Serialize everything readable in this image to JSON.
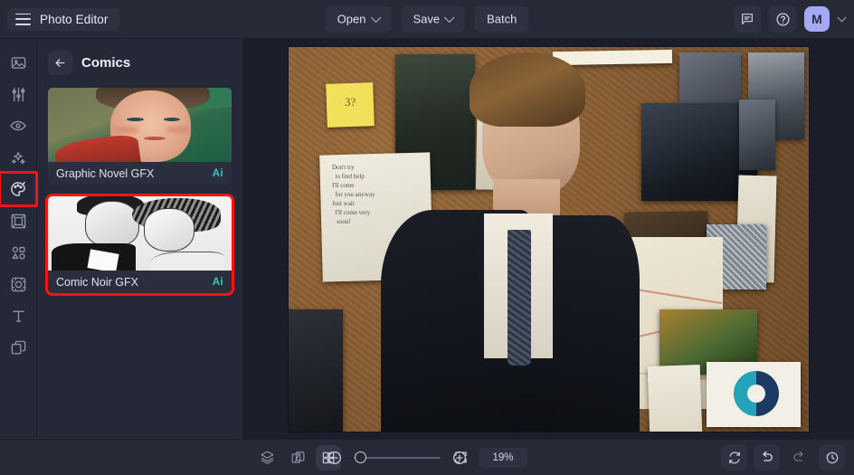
{
  "app": {
    "title": "Photo Editor",
    "menu_icon": "hamburger-icon",
    "background": "#1b1d2a",
    "surface": "#262936",
    "panel": "#252836",
    "accent_ai": "#3cc8bc",
    "accent_selection": "#f41414",
    "avatar_color": "#a5a8f5"
  },
  "header": {
    "open_label": "Open",
    "save_label": "Save",
    "batch_label": "Batch",
    "feedback_icon": "comment-icon",
    "help_icon": "help-circle-icon",
    "avatar_initial": "M",
    "avatar_chevron_icon": "chevron-down-icon"
  },
  "rail": {
    "items": [
      {
        "name": "image",
        "icon": "image-icon",
        "active": false
      },
      {
        "name": "adjust",
        "icon": "sliders-icon",
        "active": false
      },
      {
        "name": "retouch",
        "icon": "eye-icon",
        "active": false
      },
      {
        "name": "effects",
        "icon": "sparkles-icon",
        "active": false
      },
      {
        "name": "styles",
        "icon": "palette-icon",
        "active": true
      },
      {
        "name": "frames",
        "icon": "frame-icon",
        "active": false
      },
      {
        "name": "shapes",
        "icon": "shapes-icon",
        "active": false
      },
      {
        "name": "crop",
        "icon": "crop-focus-icon",
        "active": false
      },
      {
        "name": "text",
        "icon": "text-t-icon",
        "active": false
      },
      {
        "name": "layers",
        "icon": "layers-copy-icon",
        "active": false
      }
    ]
  },
  "panel": {
    "back_icon": "arrow-left-icon",
    "title": "Comics",
    "presets": [
      {
        "label": "Graphic Novel GFX",
        "badge": "Ai",
        "selected": false
      },
      {
        "label": "Comic Noir GFX",
        "badge": "Ai",
        "selected": true
      }
    ]
  },
  "canvas": {
    "description": "Man in dark suit and tie standing before an investigation corkboard with pinned photos, handwritten notes and a map",
    "sticky_note": "3?",
    "note_lines": [
      "Don't try",
      "to find help",
      "I'll come",
      "for you anyway",
      "Just wait",
      "I'll come very",
      "soon!"
    ]
  },
  "footer": {
    "layers_icon": "layers-icon",
    "compare_icon": "compare-icon",
    "grid_icon": "grid-icon",
    "fullscreen_icon": "fullscreen-icon",
    "fit_icon": "fit-screen-icon",
    "zoom_out_icon": "zoom-out-icon",
    "zoom_in_icon": "zoom-in-icon",
    "zoom_value": "19%",
    "reset_icon": "reset-icon",
    "undo_icon": "undo-icon",
    "redo_icon": "redo-icon",
    "history_icon": "history-icon"
  }
}
